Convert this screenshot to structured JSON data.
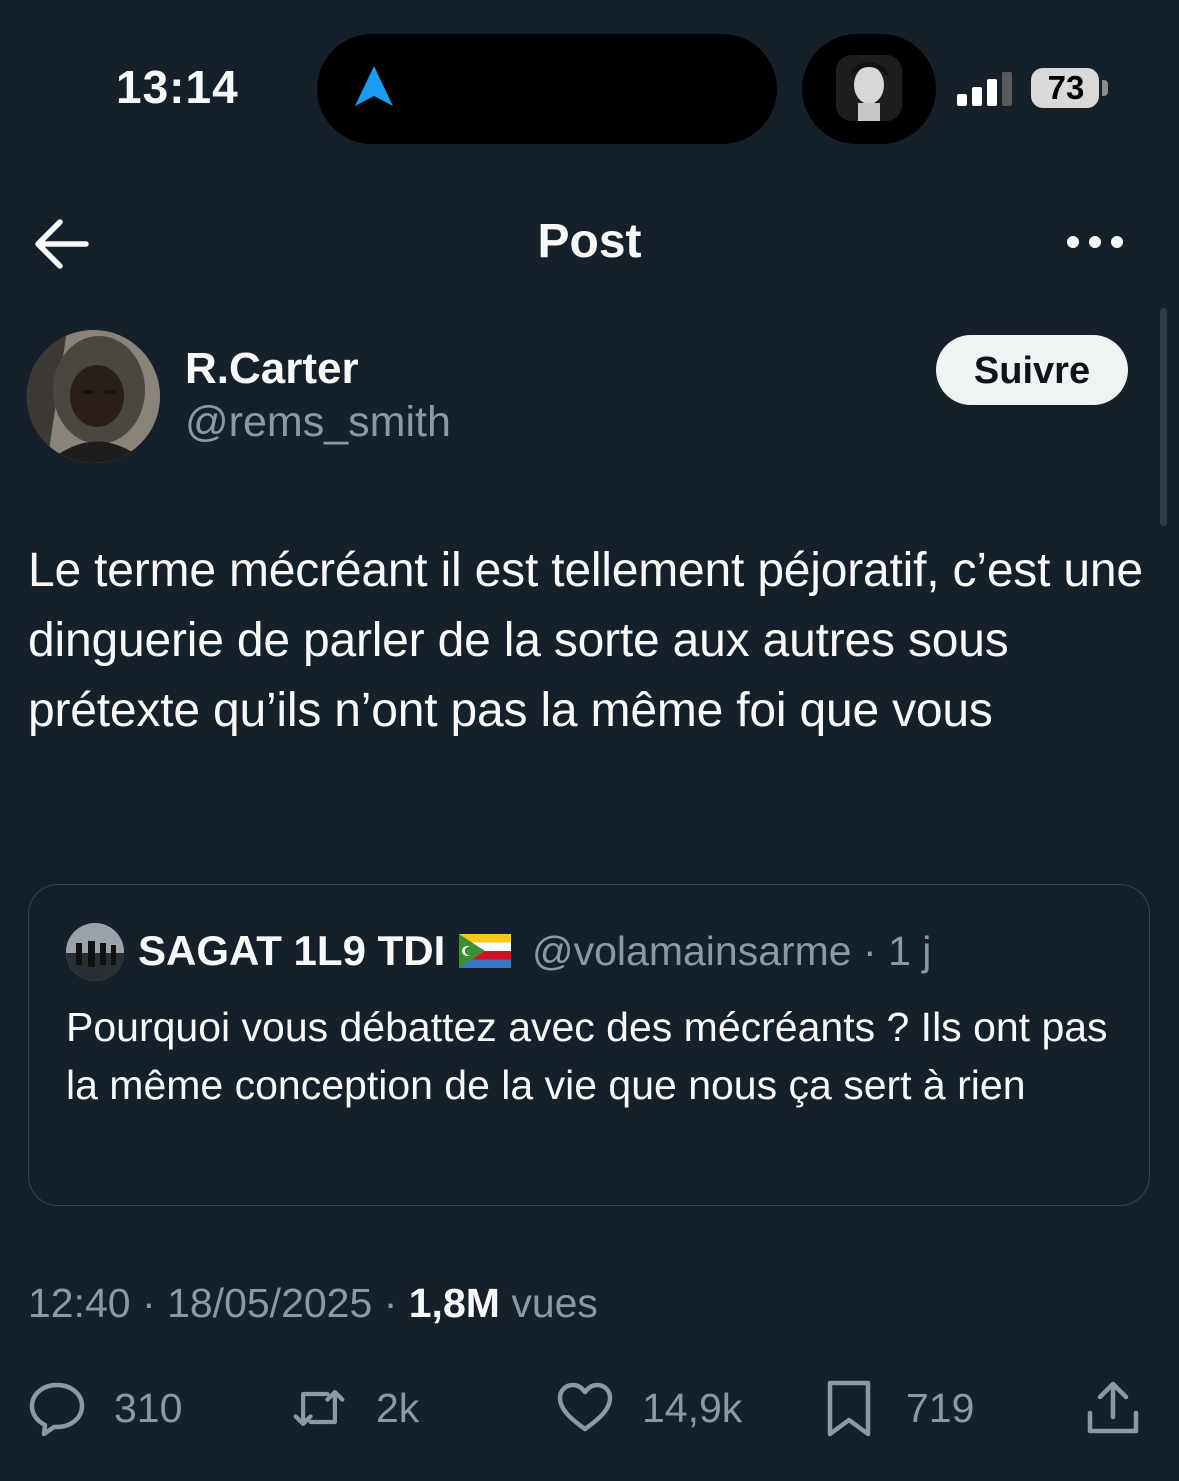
{
  "status_bar": {
    "time": "13:14",
    "battery": "73"
  },
  "header": {
    "title": "Post"
  },
  "post": {
    "author_name": "R.Carter",
    "author_handle": "@rems_smith",
    "follow_label": "Suivre",
    "text": "Le terme mécréant il est tellement péjoratif, c’est une dinguerie de parler de la sorte aux autres sous prétexte qu’ils n’ont pas la même foi que vous",
    "quote": {
      "name": "SAGAT 1L9 TDI",
      "handle": "@volamainsarme",
      "separator": "·",
      "age": "1 j",
      "text": "Pourquoi vous débattez avec des mécréants ? Ils ont pas la même conception de la vie que nous ça sert à rien"
    },
    "meta": {
      "time": "12:40",
      "date": "18/05/2025",
      "views_count": "1,8M",
      "views_label": "vues",
      "separator": "·"
    },
    "actions": {
      "replies": "310",
      "reposts": "2k",
      "likes": "14,9k",
      "bookmarks": "719"
    }
  },
  "colors": {
    "background": "#15202b",
    "text": "#f7f9f9",
    "secondary": "#8b98a5",
    "accent": "#1d9bf0",
    "border": "#38444d"
  }
}
